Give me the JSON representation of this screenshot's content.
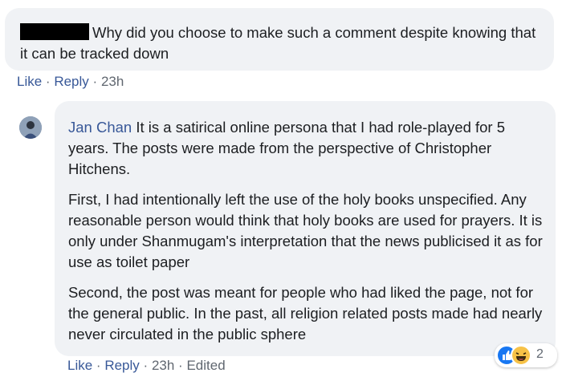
{
  "comment1": {
    "text": "Why did you choose to make such a comment despite knowing that it can be tracked down",
    "like_label": "Like",
    "reply_label": "Reply",
    "timestamp": "23h",
    "separator": "·"
  },
  "comment2": {
    "author": "Jan Chan",
    "paragraphs": [
      "It is a satirical online persona that I had role-played for 5 years. The posts were made from the perspective of Christopher Hitchens.",
      "First, I had intentionally left the use of the holy books unspecified. Any reasonable person would think that holy books are used for prayers. It is only under Shanmugam's interpretation that the news publicised it as for use as toilet paper",
      "Second, the post was meant for people who had liked the page, not for the general public. In the past, all religion related posts made had nearly never circulated in the public sphere"
    ],
    "like_label": "Like",
    "reply_label": "Reply",
    "timestamp": "23h",
    "edited_label": "Edited",
    "separator": "·",
    "reactions": {
      "icons": [
        "like-icon",
        "haha-icon"
      ],
      "count": "2"
    }
  },
  "colors": {
    "bubble": "#f0f2f5",
    "link": "#385898",
    "muted": "#606770",
    "like": "#1877f2",
    "haha": "#f7c247"
  }
}
